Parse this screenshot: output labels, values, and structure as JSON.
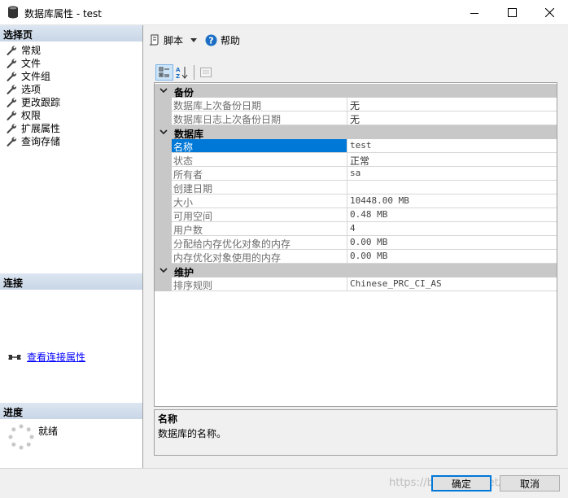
{
  "window": {
    "title": "数据库属性 - test"
  },
  "left_pane": {
    "select_page_header": "选择页",
    "pages": [
      {
        "label": "常规"
      },
      {
        "label": "文件"
      },
      {
        "label": "文件组"
      },
      {
        "label": "选项"
      },
      {
        "label": "更改跟踪"
      },
      {
        "label": "权限"
      },
      {
        "label": "扩展属性"
      },
      {
        "label": "查询存储"
      }
    ],
    "connection_header": "连接",
    "view_connection_link": "查看连接属性",
    "progress_header": "进度",
    "progress_status": "就绪"
  },
  "toolbar": {
    "script_label": "脚本",
    "help_label": "帮助"
  },
  "property_grid": {
    "categories": [
      {
        "label": "备份",
        "rows": [
          {
            "name": "数据库上次备份日期",
            "value": "无"
          },
          {
            "name": "数据库日志上次备份日期",
            "value": "无"
          }
        ]
      },
      {
        "label": "数据库",
        "rows": [
          {
            "name": "名称",
            "value": "test"
          },
          {
            "name": "状态",
            "value": "正常"
          },
          {
            "name": "所有者",
            "value": "sa"
          },
          {
            "name": "创建日期",
            "value": ""
          },
          {
            "name": "大小",
            "value": "10448.00 MB"
          },
          {
            "name": "可用空间",
            "value": "0.48 MB"
          },
          {
            "name": "用户数",
            "value": "4"
          },
          {
            "name": "分配给内存优化对象的内存",
            "value": "0.00 MB"
          },
          {
            "name": "内存优化对象使用的内存",
            "value": "0.00 MB"
          }
        ]
      },
      {
        "label": "维护",
        "rows": [
          {
            "name": "排序规则",
            "value": "Chinese_PRC_CI_AS"
          }
        ]
      }
    ],
    "selected_property": "名称"
  },
  "description": {
    "title": "名称",
    "text": "数据库的名称。"
  },
  "buttons": {
    "ok": "确定",
    "cancel": "取消"
  },
  "watermark": "https://blog.csdn.net/wmc1227",
  "colors": {
    "selection": "#0078d7",
    "category_band": "#c8c8c8",
    "link": "#0000ff",
    "pane_header": "#c9d6e6"
  }
}
